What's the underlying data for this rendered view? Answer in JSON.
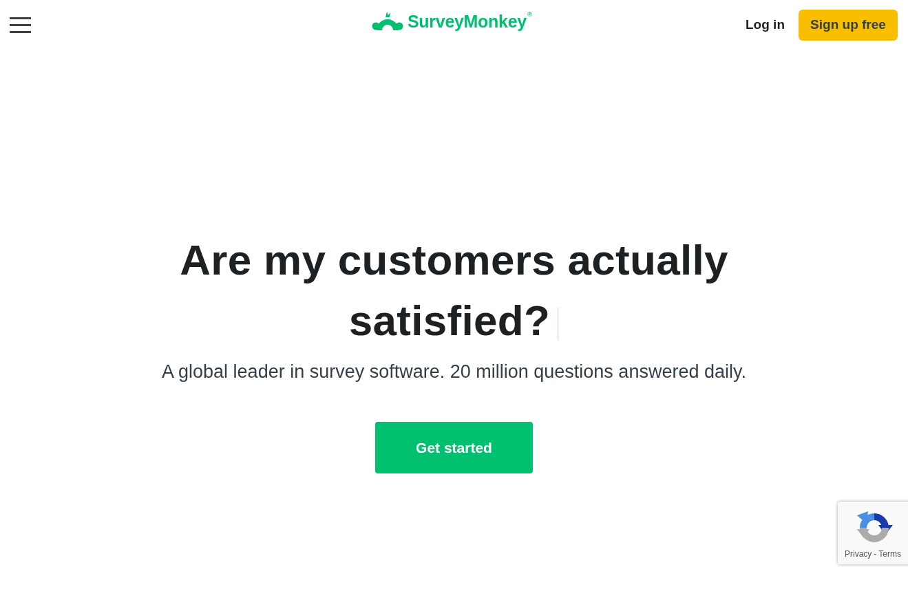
{
  "header": {
    "logo": {
      "text": "SurveyMonkey",
      "mark": "®"
    },
    "login": "Log in",
    "signup": "Sign up free"
  },
  "hero": {
    "title": "Are my customers actually satisfied?",
    "typing_cursor": true,
    "subtitle": "A global leader in survey software. 20 million questions answered daily.",
    "cta": "Get started"
  },
  "recaptcha": {
    "links": [
      "Privacy",
      "Terms"
    ],
    "separator": "-"
  }
}
